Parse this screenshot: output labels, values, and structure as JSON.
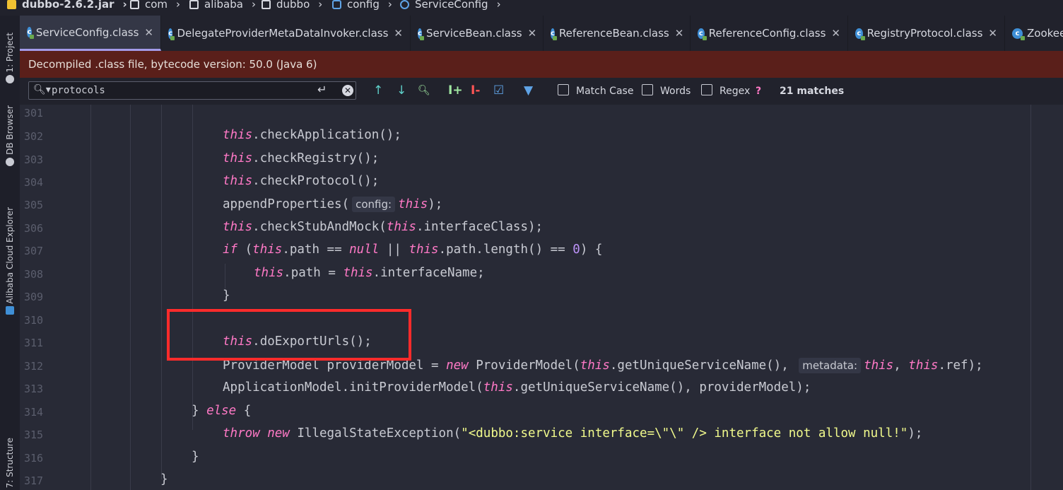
{
  "breadcrumb": [
    {
      "label": "dubbo-2.6.2.jar",
      "icon": "jar-icon"
    },
    {
      "label": "com",
      "icon": "folder-icon"
    },
    {
      "label": "alibaba",
      "icon": "folder-icon"
    },
    {
      "label": "dubbo",
      "icon": "folder-icon"
    },
    {
      "label": "config",
      "icon": "package-icon"
    },
    {
      "label": "ServiceConfig",
      "icon": "class-icon"
    }
  ],
  "tool_strip": {
    "project": "1: Project",
    "db_browser": "DB Browser",
    "alibaba_cloud": "Alibaba Cloud Explorer",
    "structure": "7: Structure"
  },
  "tabs": [
    {
      "label": "ServiceConfig.class",
      "active": true
    },
    {
      "label": "DelegateProviderMetaDataInvoker.class",
      "active": false
    },
    {
      "label": "ServiceBean.class",
      "active": false
    },
    {
      "label": "ReferenceBean.class",
      "active": false
    },
    {
      "label": "ReferenceConfig.class",
      "active": false
    },
    {
      "label": "RegistryProtocol.class",
      "active": false
    },
    {
      "label": "Zookee",
      "active": false
    }
  ],
  "banner": "Decompiled .class file, bytecode version: 50.0 (Java 6)",
  "search": {
    "value": "protocols",
    "match_case": "Match Case",
    "words": "Words",
    "regex": "Regex",
    "help": "?",
    "matches": "21 matches"
  },
  "line_numbers": [
    "301",
    "302",
    "303",
    "304",
    "305",
    "306",
    "307",
    "308",
    "309",
    "310",
    "311",
    "312",
    "313",
    "314",
    "315",
    "316",
    "317"
  ],
  "hints": {
    "config": "config:",
    "metadata": "metadata:"
  },
  "colors": {
    "highlight": "#ff2b2b",
    "banner": "#5a1f1a",
    "keyword": "#ff79c6"
  }
}
